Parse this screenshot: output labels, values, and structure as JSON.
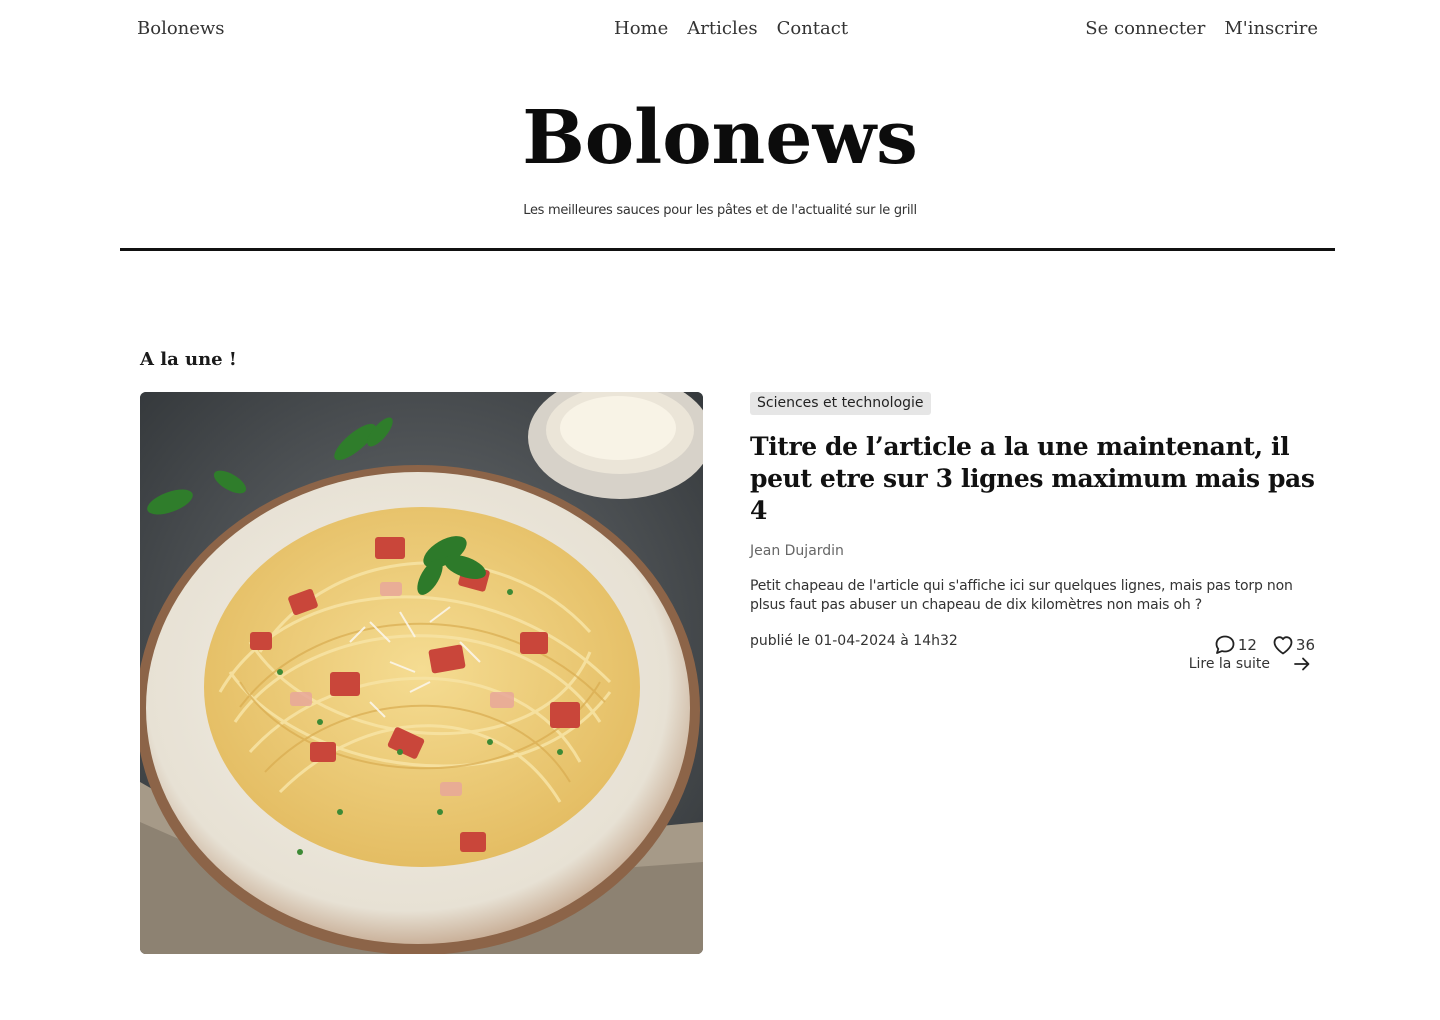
{
  "nav": {
    "brand": "Bolonews",
    "links": [
      "Home",
      "Articles",
      "Contact"
    ],
    "login": "Se connecter",
    "signup": "M'inscrire"
  },
  "masthead": {
    "title": "Bolonews",
    "tagline": "Les meilleures sauces pour les pâtes et de l'actualité sur le grill"
  },
  "featured": {
    "section_title": "A la une !",
    "image_icon": "spaghetti-carbonara-photo",
    "category": "Sciences et technologie",
    "title": "Titre de l’article a la une maintenant, il peut etre sur 3 lignes maximum mais pas 4",
    "author": "Jean Dujardin",
    "excerpt": "Petit chapeau de l'article qui s'affiche ici sur quelques lignes, mais pas torp non plsus faut pas abuser un chapeau de dix kilomètres non mais oh ?",
    "published": "publié le 01-04-2024 à 14h32",
    "comments_count": "12",
    "likes_count": "36",
    "read_more": "Lire la suite"
  }
}
